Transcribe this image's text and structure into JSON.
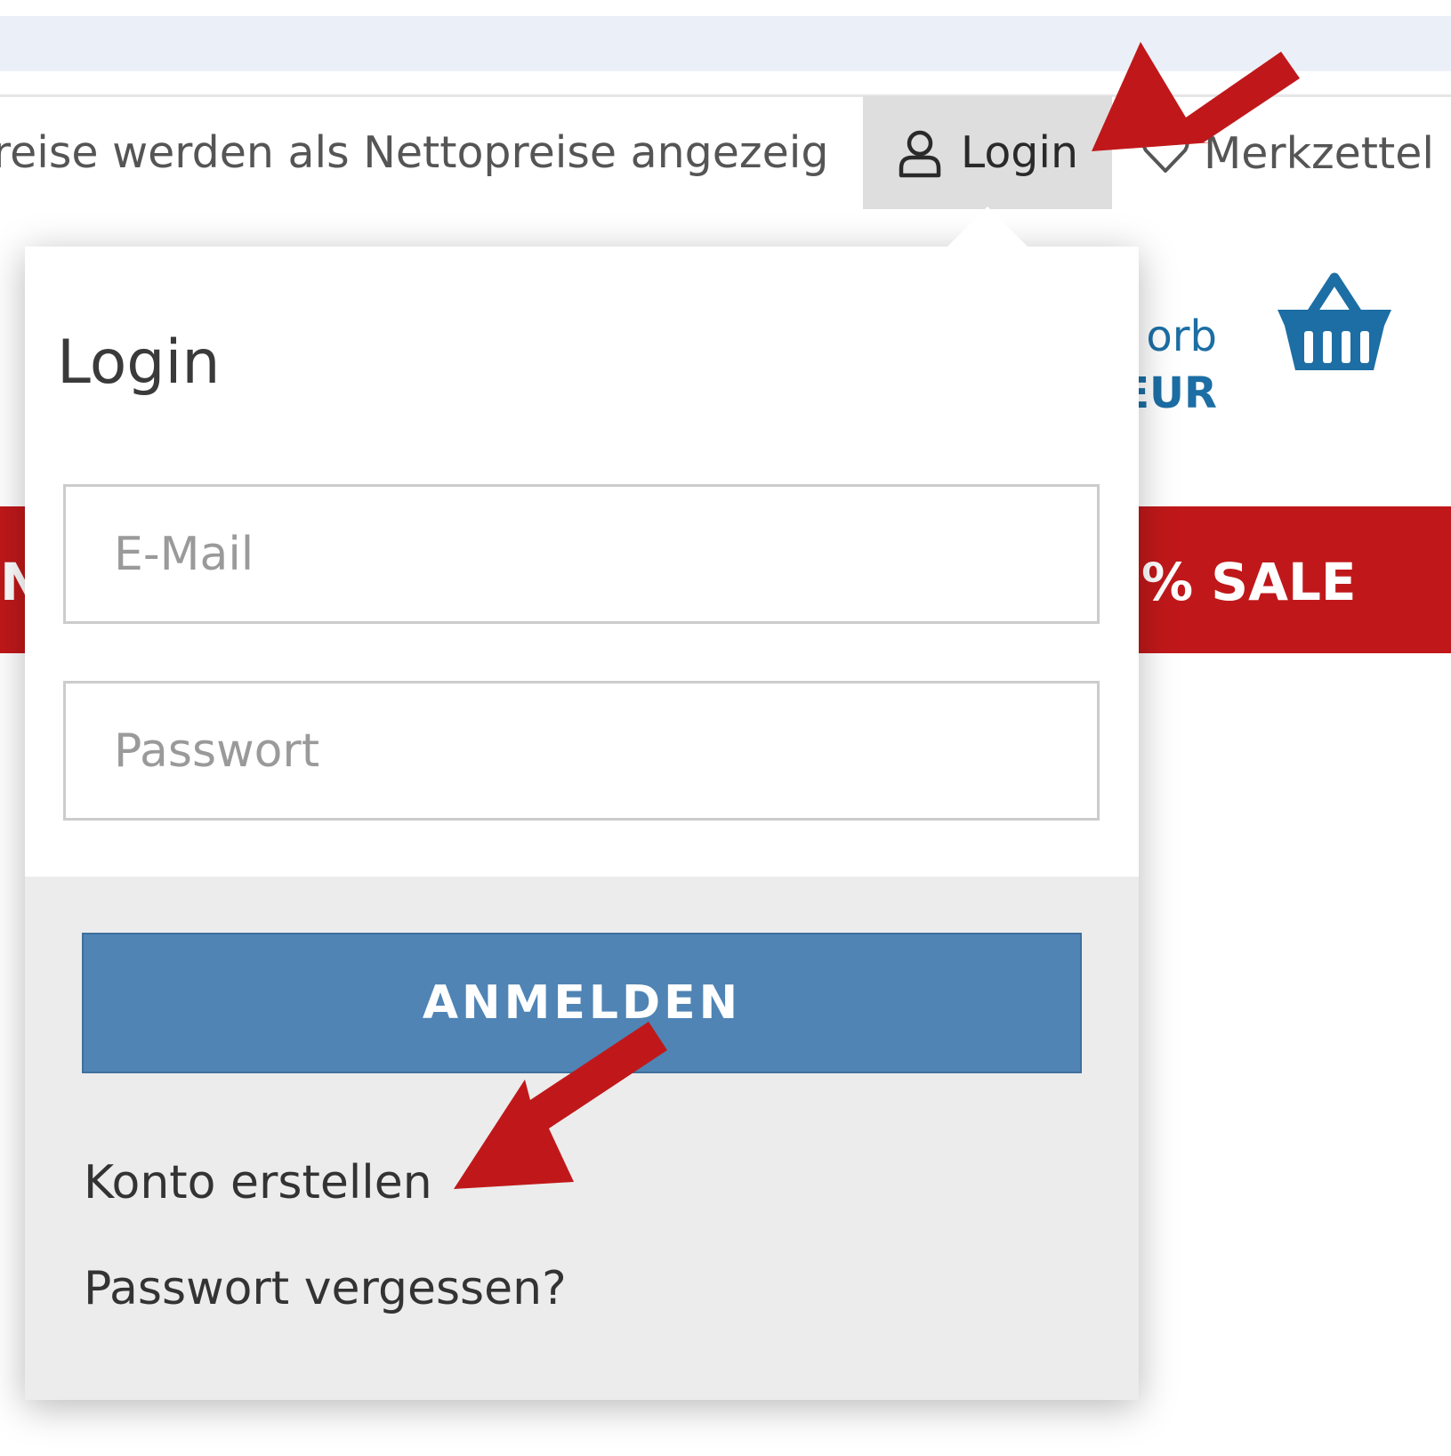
{
  "topbar": {
    "notice": "reise werden als Nettopreise angezeigt...",
    "login_label": "Login",
    "wishlist_label": "Merkzettel"
  },
  "cart": {
    "label": "orb",
    "amount": "EUR"
  },
  "banner": {
    "left_text": "N",
    "sale_text": "% SALE"
  },
  "login_dropdown": {
    "title": "Login",
    "email_placeholder": "E-Mail",
    "password_placeholder": "Passwort",
    "submit_label": "ANMELDEN",
    "create_account_label": "Konto erstellen",
    "forgot_password_label": "Passwort vergessen?"
  },
  "icons": {
    "user": "user-icon",
    "wishlist": "heart-icon",
    "cart": "basket-icon"
  },
  "colors": {
    "accent_blue": "#1c6ea4",
    "button_blue": "#4f84b5",
    "sale_red": "#c0181a",
    "arrow_red": "#c0181a",
    "footer_gray": "#ececec",
    "tab_gray": "#dedede"
  }
}
